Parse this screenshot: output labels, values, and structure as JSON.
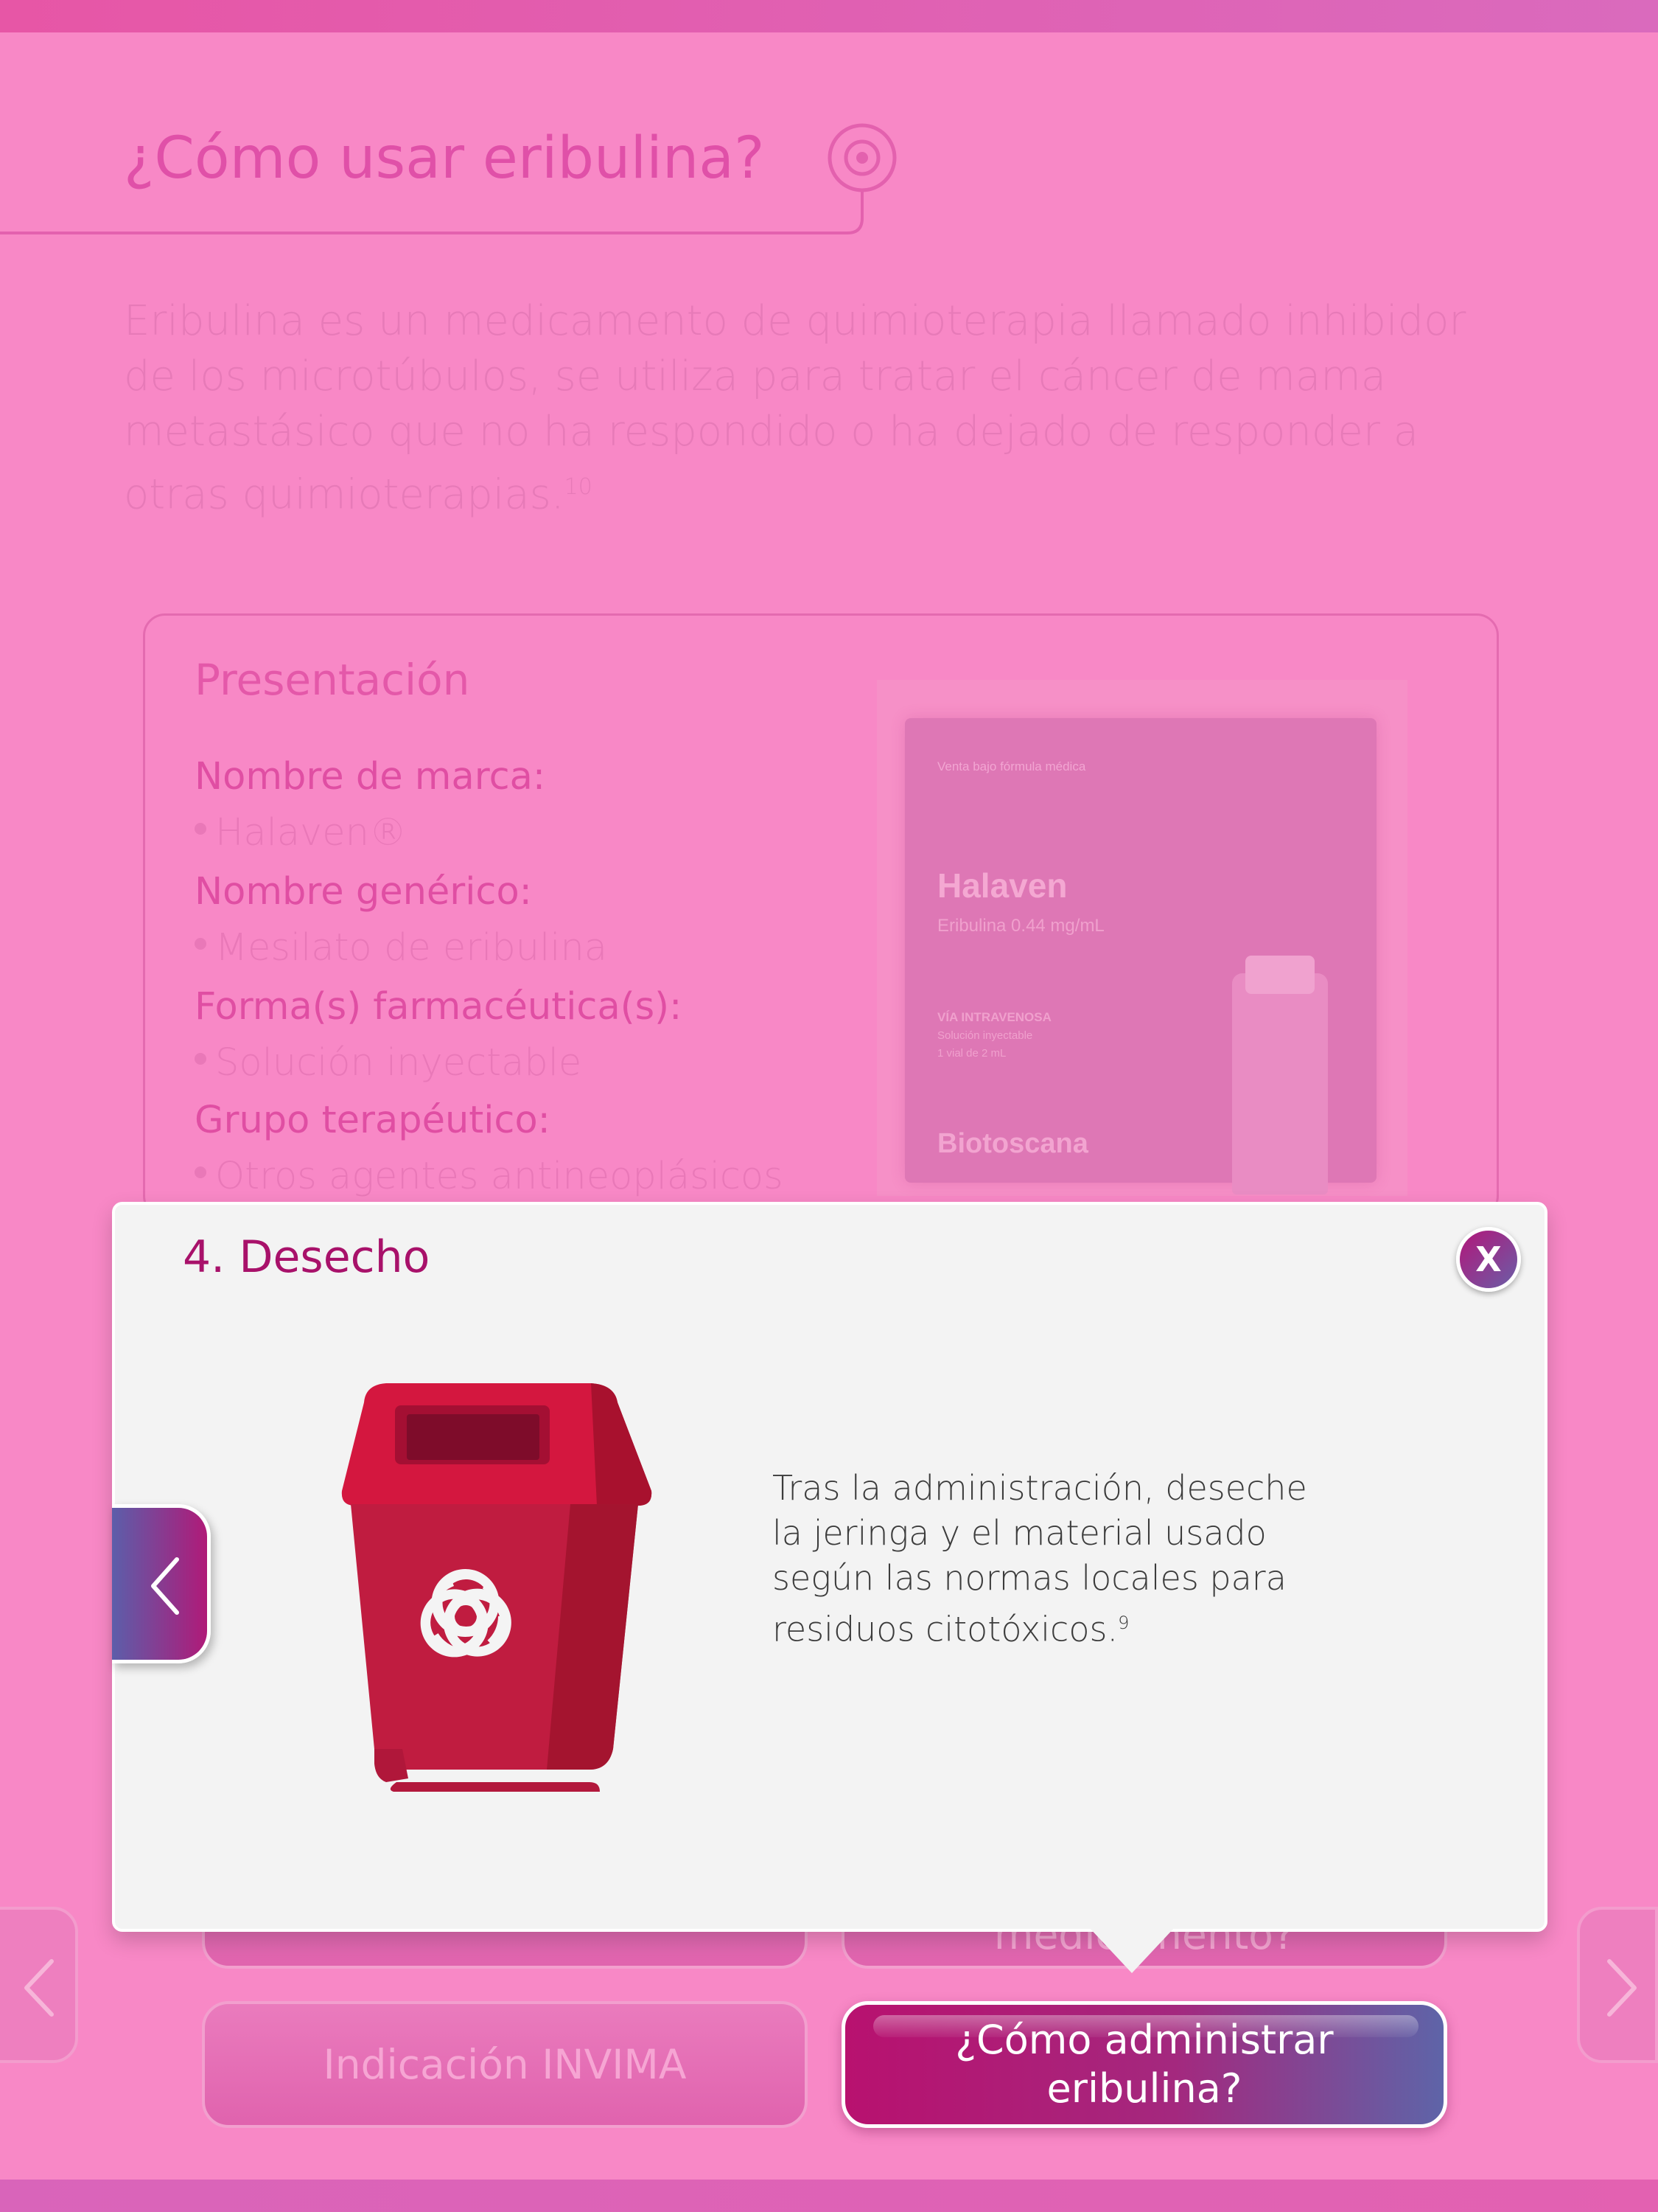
{
  "page": {
    "title": "¿Cómo usar eribulina?",
    "intro": "Eribulina es un medicamento de quimioterapia llamado inhibidor de los microtúbulos, se utiliza para tratar el cáncer de mama metastásico que no ha respondido o ha dejado de responder a otras quimioterapias.",
    "intro_ref": "10"
  },
  "presentation": {
    "title": "Presentación",
    "brand_label": "Nombre de marca:",
    "brand_value": "Halaven®",
    "generic_label": "Nombre genérico:",
    "generic_value": "Mesilato de eribulina",
    "form_label": "Forma(s) farmacéutica(s):",
    "form_value": "Solución inyectable",
    "group_label": "Grupo terapéutico:",
    "group_value": "Otros agentes antineoplásicos"
  },
  "package": {
    "top_text": "Venta bajo fórmula médica",
    "brand": "Halaven",
    "concentration": "Eribulina 0.44 mg/mL",
    "route": "VÍA INTRAVENOSA",
    "form": "Solución inyectable",
    "volume": "1 vial de 2 mL",
    "maker": "Biotoscana"
  },
  "modal": {
    "title": "4. Desecho",
    "close_label": "X",
    "text": "Tras la administración, deseche la jeringa y el material usado según las normas locales para residuos citotóxicos.",
    "text_ref": "9"
  },
  "nav": {
    "btn_top_right_partial": "medicamento?",
    "btn_indicacion": "Indicación INVIMA",
    "btn_administrar_line1": "¿Cómo administrar",
    "btn_administrar_line2": "eribulina?"
  },
  "colors": {
    "background": "#f888c6",
    "accent": "#a8116a",
    "modal_bg": "#f3f3f3",
    "bin_red": "#c8183e"
  },
  "icons": {
    "close": "close-icon",
    "prev": "chevron-left-icon",
    "next": "chevron-right-icon",
    "bin": "biohazard-bin-icon",
    "target": "target-icon"
  }
}
